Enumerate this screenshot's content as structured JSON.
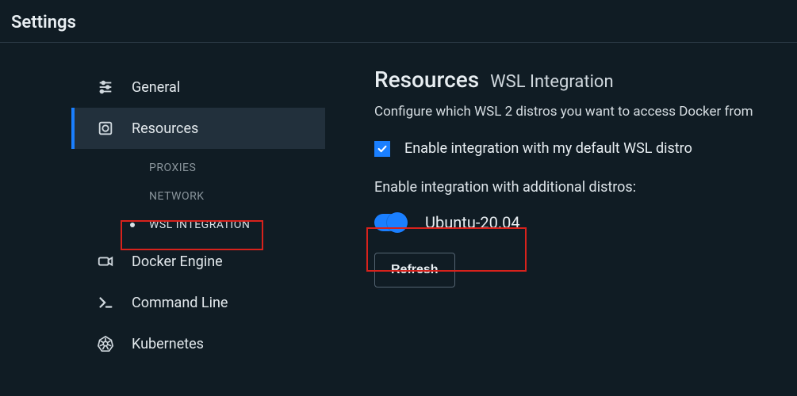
{
  "header": {
    "title": "Settings"
  },
  "sidebar": {
    "items": [
      {
        "label": "General"
      },
      {
        "label": "Resources"
      },
      {
        "label": "Docker Engine"
      },
      {
        "label": "Command Line"
      },
      {
        "label": "Kubernetes"
      }
    ],
    "resources_subitems": [
      {
        "label": "PROXIES"
      },
      {
        "label": "NETWORK"
      },
      {
        "label": "WSL INTEGRATION",
        "selected": true
      }
    ]
  },
  "content": {
    "title": "Resources",
    "subtitle": "WSL Integration",
    "description": "Configure which WSL 2 distros you want to access Docker from",
    "enable_default_checkbox": {
      "checked": true,
      "label": "Enable integration with my default WSL distro"
    },
    "additional_label": "Enable integration with additional distros:",
    "distros": [
      {
        "name": "Ubuntu-20.04",
        "enabled": true
      }
    ],
    "refresh_label": "Refresh"
  },
  "colors": {
    "accent": "#1a7fff",
    "highlight": "#d8221c",
    "bg": "#101c24",
    "panel_active": "#22303c"
  }
}
